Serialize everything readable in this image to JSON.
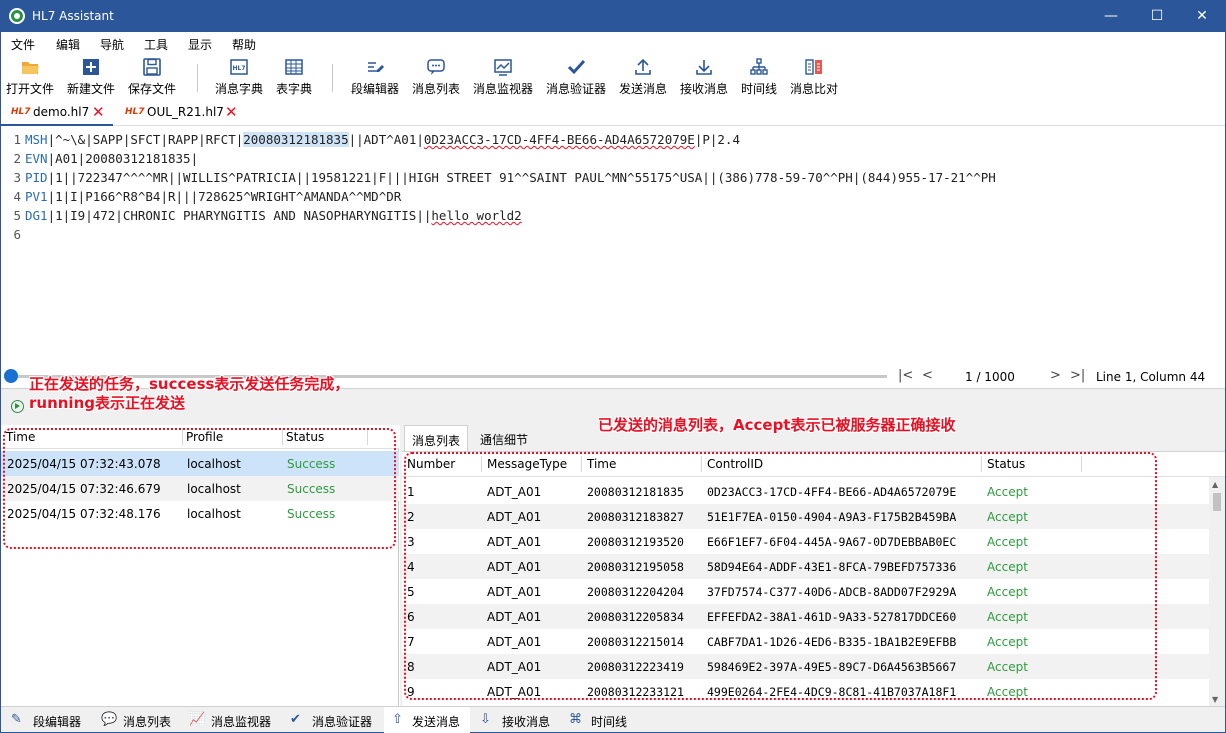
{
  "window": {
    "title": "HL7 Assistant",
    "minimize": "—",
    "maximize": "☐",
    "close": "✕"
  },
  "menu": [
    "文件",
    "编辑",
    "导航",
    "工具",
    "显示",
    "帮助"
  ],
  "toolbar": {
    "open_file": "打开文件",
    "new_file": "新建文件",
    "save_file": "保存文件",
    "msg_dict": "消息字典",
    "table_dict": "表字典",
    "seg_editor": "段编辑器",
    "msg_list": "消息列表",
    "msg_monitor": "消息监视器",
    "msg_validator": "消息验证器",
    "send_msg": "发送消息",
    "recv_msg": "接收消息",
    "timeline": "时间线",
    "msg_compare": "消息比对"
  },
  "file_tabs": [
    {
      "badge": "HL7",
      "label": "demo.hl7",
      "close": "✕"
    },
    {
      "badge": "HL7",
      "label": "OUL_R21.hl7",
      "close": "✕"
    }
  ],
  "editor": {
    "line_numbers": [
      "1",
      "2",
      "3",
      "4",
      "5",
      "6"
    ],
    "line1": {
      "seg": "MSH",
      "a": "|^~\\&|SAPP|SFCT|RAPP|RFCT|",
      "sel": "20080312181835",
      "b": "||ADT^A01|",
      "squig": "0D23ACC3-17CD-4FF4-BE66-AD4A6572079E",
      "c": "|P|2.4"
    },
    "line2": {
      "seg": "EVN",
      "rest": "|A01|20080312181835|"
    },
    "line3": {
      "seg": "PID",
      "rest": "|1||722347^^^^MR||WILLIS^PATRICIA||19581221|F|||HIGH STREET 91^^SAINT PAUL^MN^55175^USA||(386)778-59-70^^PH|(844)955-17-21^^PH"
    },
    "line4": {
      "seg": "PV1",
      "rest": "|1|I|P166^R8^B4|R|||728625^WRIGHT^AMANDA^^MD^DR"
    },
    "line5": {
      "seg": "DG1",
      "a": "|1|I9|472|CHRONIC PHARYNGITIS AND NASOPHARYNGITIS||",
      "squig": "hello world2"
    }
  },
  "nav": {
    "first": "|<",
    "prev": "<",
    "page": "1 / 1000",
    "next": ">",
    "last": ">|",
    "cursor": "Line 1, Column 44"
  },
  "tasks": {
    "headers": {
      "time": "Time",
      "profile": "Profile",
      "status": "Status"
    },
    "rows": [
      {
        "time": "2025/04/15 07:32:43.078",
        "profile": "localhost",
        "status": "Success"
      },
      {
        "time": "2025/04/15 07:32:46.679",
        "profile": "localhost",
        "status": "Success"
      },
      {
        "time": "2025/04/15 07:32:48.176",
        "profile": "localhost",
        "status": "Success"
      }
    ]
  },
  "msg_panel": {
    "tabs": [
      "消息列表",
      "通信细节"
    ],
    "headers": {
      "number": "Number",
      "type": "MessageType",
      "time": "Time",
      "control": "ControlID",
      "status": "Status"
    },
    "rows": [
      {
        "number": "1",
        "type": "ADT_A01",
        "time": "20080312181835",
        "control": "0D23ACC3-17CD-4FF4-BE66-AD4A6572079E",
        "status": "Accept"
      },
      {
        "number": "2",
        "type": "ADT_A01",
        "time": "20080312183827",
        "control": "51E1F7EA-0150-4904-A9A3-F175B2B459BA",
        "status": "Accept"
      },
      {
        "number": "3",
        "type": "ADT_A01",
        "time": "20080312193520",
        "control": "E66F1EF7-6F04-445A-9A67-0D7DEBBAB0EC",
        "status": "Accept"
      },
      {
        "number": "4",
        "type": "ADT_A01",
        "time": "20080312195058",
        "control": "58D94E64-ADDF-43E1-8FCA-79BEFD757336",
        "status": "Accept"
      },
      {
        "number": "5",
        "type": "ADT_A01",
        "time": "20080312204204",
        "control": "37FD7574-C377-40D6-ADCB-8ADD07F2929A",
        "status": "Accept"
      },
      {
        "number": "6",
        "type": "ADT_A01",
        "time": "20080312205834",
        "control": "EFFEFDA2-38A1-461D-9A33-527817DDCE60",
        "status": "Accept"
      },
      {
        "number": "7",
        "type": "ADT_A01",
        "time": "20080312215014",
        "control": "CABF7DA1-1D26-4ED6-B335-1BA1B2E9EFBB",
        "status": "Accept"
      },
      {
        "number": "8",
        "type": "ADT_A01",
        "time": "20080312223419",
        "control": "598469E2-397A-49E5-89C7-D6A4563B5667",
        "status": "Accept"
      },
      {
        "number": "9",
        "type": "ADT_A01",
        "time": "20080312233121",
        "control": "499E0264-2FE4-4DC9-8C81-41B7037A18F1",
        "status": "Accept"
      }
    ]
  },
  "bottom_tabs": [
    "段编辑器",
    "消息列表",
    "消息监视器",
    "消息验证器",
    "发送消息",
    "接收消息",
    "时间线"
  ],
  "annotations": {
    "tasks_line1": "正在发送的任务，success表示发送任务完成，",
    "tasks_line2": "running表示正在发送",
    "messages": "已发送的消息列表，Accept表示已被服务器正确接收"
  },
  "colors": {
    "accent": "#2b579a",
    "success": "#2e9b3e",
    "annotation": "#e81123",
    "selection": "#cde3fa"
  }
}
